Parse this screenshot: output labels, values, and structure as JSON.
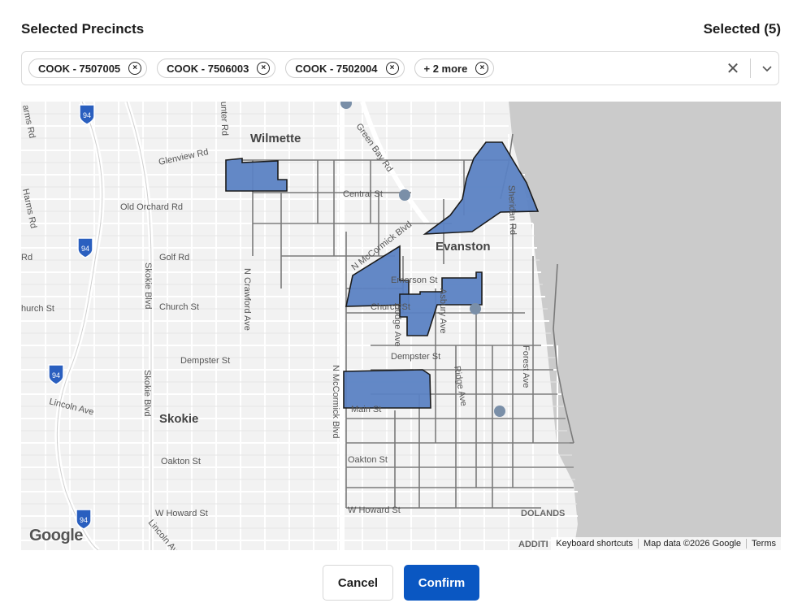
{
  "header": {
    "title": "Selected Precincts",
    "count_label": "Selected (5)"
  },
  "selector": {
    "chips": [
      "COOK - 7507005",
      "COOK - 7506003",
      "COOK - 7502004",
      "+ 2 more"
    ],
    "remove_glyph": "×",
    "clear_glyph": "✕"
  },
  "map": {
    "places": {
      "wilmette": "Wilmette",
      "evanston": "Evanston",
      "skokie": "Skokie",
      "dolands": "DOLANDS",
      "additi": "ADDITI"
    },
    "streets": {
      "glenview": "Glenview Rd",
      "old_orchard": "Old Orchard Rd",
      "golf": "Golf Rd",
      "church_w": "hurch St",
      "dempster_w": "Dempster St",
      "lincoln": "Lincoln Ave",
      "oakton_w": "Oakton St",
      "howard_w": "W Howard St",
      "lincoln_s": "Lincoln Ave",
      "harms": "Harms Rd",
      "harms2": "arms Rd",
      "rd_left": "Rd",
      "skokie_blvd": "Skokie Blvd",
      "skokie_blvd2": "Skokie Blvd",
      "crawford": "N Crawford Ave",
      "mccormick_s": "N McCormick Blvd",
      "mccormick_n": "N McCormick Blvd",
      "green_bay": "Green Bay Rd",
      "central": "Central St",
      "emerson": "Emerson St",
      "church_e": "Church St",
      "dodge": "Dodge Ave",
      "asbury": "Asbury Ave",
      "dempster_e": "Dempster St",
      "ridge": "Ridge Ave",
      "main": "Main St",
      "oakton_e": "Oakton St",
      "howard_e": "W Howard St",
      "forest": "Forest Ave",
      "sheridan": "Sheridan Rd",
      "hunter": "unter Rd"
    },
    "shields": [
      "94",
      "94",
      "94",
      "94"
    ],
    "selected_fill": "#5b82c3",
    "water_color": "#c9c9c9",
    "attribution": {
      "shortcuts": "Keyboard shortcuts",
      "data": "Map data ©2026 Google",
      "terms": "Terms"
    },
    "logo": "Google"
  },
  "footer": {
    "cancel_label": "Cancel",
    "confirm_label": "Confirm"
  }
}
